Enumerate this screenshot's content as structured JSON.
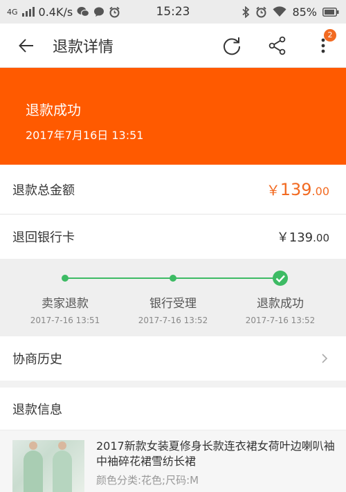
{
  "statusbar": {
    "network": "4G",
    "speed": "0.4K/s",
    "time": "15:23",
    "battery": "85%"
  },
  "appbar": {
    "title": "退款详情",
    "badge": "2"
  },
  "banner": {
    "status": "退款成功",
    "time": "2017年7月16日 13:51",
    "color": "#ff5a00"
  },
  "summary": {
    "total_label": "退款总金额",
    "total_currency": "￥",
    "total_int": "139",
    "total_dec": ".00",
    "bank_label": "退回银行卡",
    "bank_currency": "￥",
    "bank_int": "139",
    "bank_dec": ".00"
  },
  "progress": {
    "color": "#3dbb64",
    "steps": [
      {
        "name": "卖家退款",
        "time": "2017-7-16 13:51"
      },
      {
        "name": "银行受理",
        "time": "2017-7-16 13:52"
      },
      {
        "name": "退款成功",
        "time": "2017-7-16 13:52"
      }
    ]
  },
  "history": {
    "label": "协商历史"
  },
  "refund_info": {
    "title": "退款信息",
    "product_name": "2017新款女装夏修身长款连衣裙女荷叶边喇叭袖中袖碎花裙雪纺长裙",
    "variant": "颜色分类:花色;尺码:M"
  },
  "icons": {
    "back": "arrow-left-icon",
    "refresh": "refresh-icon",
    "share": "share-icon",
    "more": "more-vertical-icon",
    "chevron": "chevron-right-icon",
    "check": "check-icon"
  }
}
